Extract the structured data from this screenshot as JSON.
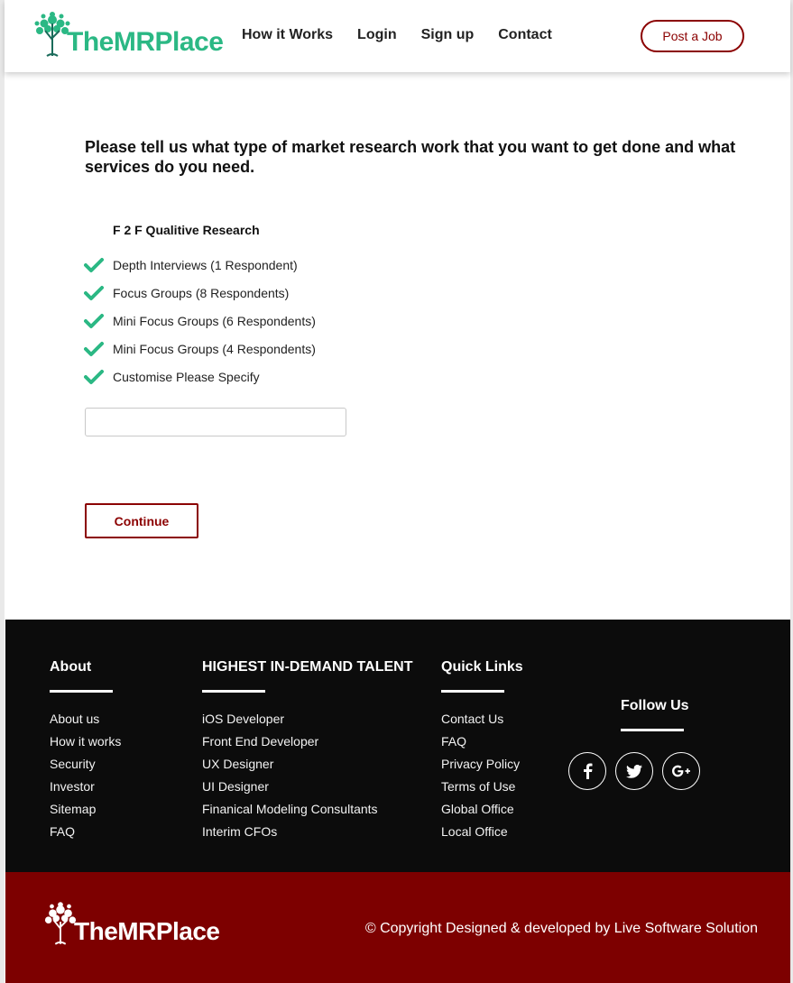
{
  "header": {
    "brand": "TheMRPlace",
    "nav": [
      "How it Works",
      "Login",
      "Sign up",
      "Contact"
    ],
    "post_job": "Post a Job"
  },
  "main": {
    "title": "Please tell us what type of market research work that you want to get done and what services do you need.",
    "section_label": "F 2 F Qualitive Research",
    "options": [
      "Depth Interviews (1 Respondent)",
      "Focus Groups (8 Respondents)",
      "Mini Focus Groups (6 Respondents)",
      "Mini Focus Groups (4 Respondents)",
      "Customise Please Specify"
    ],
    "specify_value": "",
    "continue": "Continue"
  },
  "footer": {
    "about": {
      "title": "About",
      "items": [
        "About us",
        "How it works",
        "Security",
        "Investor",
        "Sitemap",
        "FAQ"
      ]
    },
    "talent": {
      "title": "HIGHEST IN-DEMAND TALENT",
      "items": [
        "iOS Developer",
        "Front End Developer",
        "UX Designer",
        "UI Designer",
        "Finanical Modeling Consultants",
        "Interim CFOs"
      ]
    },
    "quick_links": {
      "title": "Quick Links",
      "items": [
        "Contact Us",
        "FAQ",
        "Privacy Policy",
        "Terms of Use",
        "Global Office",
        "Local Office"
      ]
    },
    "follow": {
      "title": "Follow Us",
      "icons": [
        "facebook-icon",
        "twitter-icon",
        "google-plus-icon"
      ]
    }
  },
  "bottom": {
    "brand": "TheMRPlace",
    "copyright": "© Copyright Designed & developed by Live Software Solution"
  },
  "colors": {
    "brand_green": "#2bb884",
    "accent_red": "#8b0000",
    "footer_bg": "#0c0c0c",
    "bottom_bg": "#7d0000"
  }
}
